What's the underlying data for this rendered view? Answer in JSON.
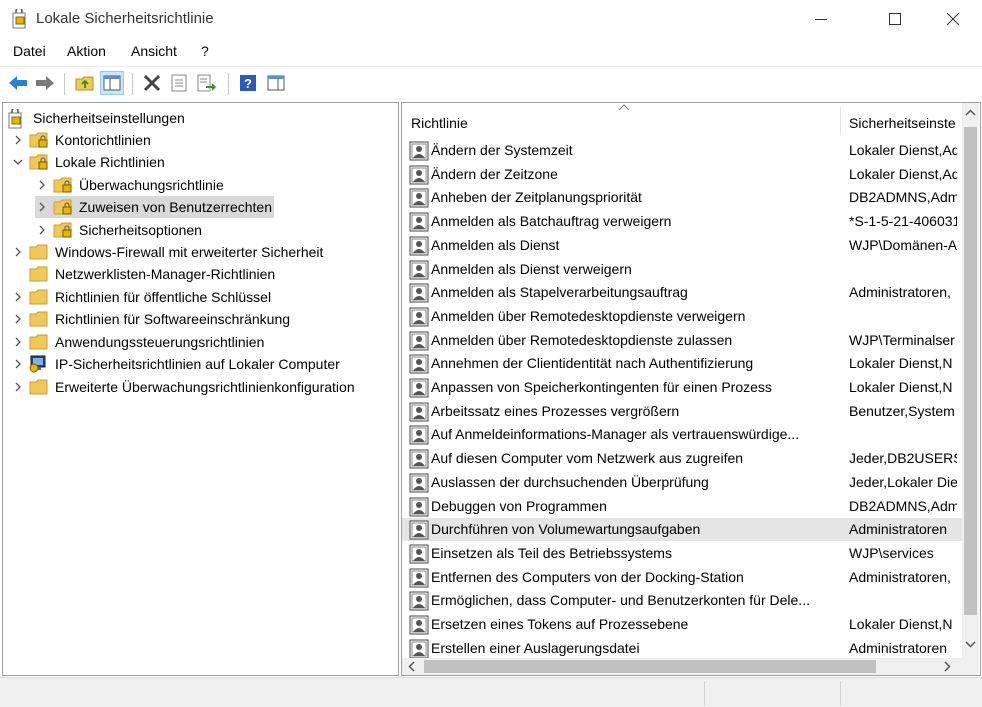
{
  "window": {
    "title": "Lokale Sicherheitsrichtlinie"
  },
  "menu": {
    "items": [
      "Datei",
      "Aktion",
      "Ansicht",
      "?"
    ]
  },
  "tree": {
    "items": [
      {
        "label": "Sicherheitseinstellungen",
        "level": 0,
        "expander": "none",
        "icon": "security-settings-icon"
      },
      {
        "label": "Kontorichtlinien",
        "level": 1,
        "expander": "collapsed",
        "icon": "locked-folder-icon"
      },
      {
        "label": "Lokale Richtlinien",
        "level": 1,
        "expander": "expanded",
        "icon": "locked-folder-icon"
      },
      {
        "label": "Überwachungsrichtlinie",
        "level": 2,
        "expander": "collapsed",
        "icon": "locked-folder-icon"
      },
      {
        "label": "Zuweisen von Benutzerrechten",
        "level": 2,
        "expander": "collapsed",
        "icon": "locked-folder-icon",
        "selected": true
      },
      {
        "label": "Sicherheitsoptionen",
        "level": 2,
        "expander": "collapsed",
        "icon": "locked-folder-icon"
      },
      {
        "label": "Windows-Firewall mit erweiterter Sicherheit",
        "level": 1,
        "expander": "collapsed",
        "icon": "folder-icon"
      },
      {
        "label": "Netzwerklisten-Manager-Richtlinien",
        "level": 1,
        "expander": "none",
        "icon": "folder-icon"
      },
      {
        "label": "Richtlinien für öffentliche Schlüssel",
        "level": 1,
        "expander": "collapsed",
        "icon": "folder-icon"
      },
      {
        "label": "Richtlinien für Softwareeinschränkung",
        "level": 1,
        "expander": "collapsed",
        "icon": "folder-icon"
      },
      {
        "label": "Anwendungssteuerungsrichtlinien",
        "level": 1,
        "expander": "collapsed",
        "icon": "folder-icon"
      },
      {
        "label": "IP-Sicherheitsrichtlinien auf Lokaler Computer",
        "level": 1,
        "expander": "collapsed",
        "icon": "ip-security-icon"
      },
      {
        "label": "Erweiterte Überwachungsrichtlinienkonfiguration",
        "level": 1,
        "expander": "collapsed",
        "icon": "folder-icon"
      }
    ]
  },
  "list": {
    "columns": [
      "Richtlinie",
      "Sicherheitseinste"
    ],
    "rows": [
      {
        "policy": "Ändern der Systemzeit",
        "setting": "Lokaler Dienst,Ad"
      },
      {
        "policy": "Ändern der Zeitzone",
        "setting": "Lokaler Dienst,Ad"
      },
      {
        "policy": "Anheben der Zeitplanungspriorität",
        "setting": "DB2ADMNS,Adm"
      },
      {
        "policy": "Anmelden als Batchauftrag verweigern",
        "setting": "*S-1-5-21-406031"
      },
      {
        "policy": "Anmelden als Dienst",
        "setting": "WJP\\Domänen-A"
      },
      {
        "policy": "Anmelden als Dienst verweigern",
        "setting": ""
      },
      {
        "policy": "Anmelden als Stapelverarbeitungsauftrag",
        "setting": "Administratoren,"
      },
      {
        "policy": "Anmelden über Remotedesktopdienste verweigern",
        "setting": ""
      },
      {
        "policy": "Anmelden über Remotedesktopdienste zulassen",
        "setting": "WJP\\Terminalser"
      },
      {
        "policy": "Annehmen der Clientidentität nach Authentifizierung",
        "setting": "Lokaler Dienst,N"
      },
      {
        "policy": "Anpassen von Speicherkontingenten für einen Prozess",
        "setting": "Lokaler Dienst,N"
      },
      {
        "policy": "Arbeitssatz eines Prozesses vergrößern",
        "setting": "Benutzer,System"
      },
      {
        "policy": "Auf Anmeldeinformations-Manager als vertrauenswürdige...",
        "setting": ""
      },
      {
        "policy": "Auf diesen Computer vom Netzwerk aus zugreifen",
        "setting": "Jeder,DB2USERS,"
      },
      {
        "policy": "Auslassen der durchsuchenden Überprüfung",
        "setting": "Jeder,Lokaler Die"
      },
      {
        "policy": "Debuggen von Programmen",
        "setting": "DB2ADMNS,Adm"
      },
      {
        "policy": "Durchführen von Volumewartungsaufgaben",
        "setting": "Administratoren",
        "highlighted": true
      },
      {
        "policy": "Einsetzen als Teil des Betriebssystems",
        "setting": "WJP\\services"
      },
      {
        "policy": "Entfernen des Computers von der Docking-Station",
        "setting": "Administratoren,"
      },
      {
        "policy": "Ermöglichen, dass Computer- und Benutzerkonten für Dele...",
        "setting": ""
      },
      {
        "policy": "Ersetzen eines Tokens auf Prozessebene",
        "setting": "Lokaler Dienst,N"
      },
      {
        "policy": "Erstellen einer Auslagerungsdatei",
        "setting": "Administratoren"
      }
    ]
  },
  "colors": {
    "accent": "#0078d7",
    "selected": "#d9d9d9",
    "folder": "#f0c857"
  }
}
